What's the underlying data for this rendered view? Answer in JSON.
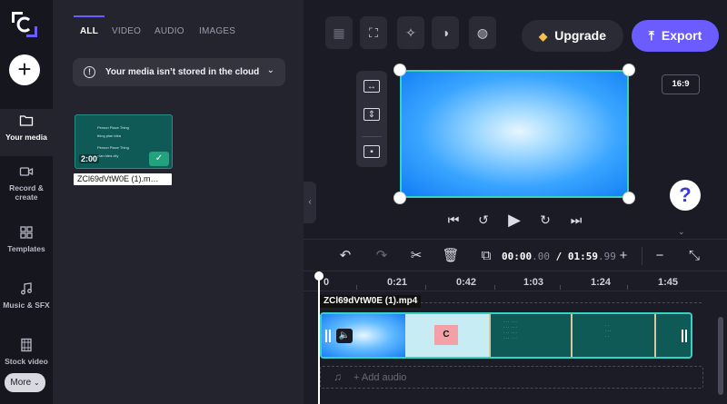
{
  "rail": {
    "items": [
      {
        "label": "Your media",
        "icon": "folder-icon"
      },
      {
        "label": "Record & create",
        "icon": "camera-icon"
      },
      {
        "label": "Templates",
        "icon": "templates-icon"
      },
      {
        "label": "Music & SFX",
        "icon": "music-icon"
      },
      {
        "label": "Stock video",
        "icon": "film-icon"
      }
    ],
    "more_label": "More",
    "add_symbol": "+"
  },
  "media": {
    "tabs": [
      "ALL",
      "VIDEO",
      "AUDIO",
      "IMAGES"
    ],
    "banner_text": "Your media isn’t stored in the cloud",
    "banner_chevron": "⌄",
    "info_symbol": "!",
    "thumb": {
      "duration": "2:00",
      "filename": "ZCl69dVtW0E (1).m…",
      "check": "✓",
      "grid_text": [
        "Person Place Thing",
        "thing plan idea",
        "Person Place Thing",
        "plan idea city"
      ]
    }
  },
  "toolbar": {
    "upgrade_label": "Upgrade",
    "export_label": "Export",
    "tool_icons": [
      "layout-icon",
      "crop-icon",
      "magic-wand-icon",
      "contrast-icon",
      "filter-icon"
    ]
  },
  "preview": {
    "aspect_label": "16:9",
    "help_symbol": "?"
  },
  "timeline": {
    "timecode_current": "00:00",
    "timecode_current_ms": ".00",
    "timecode_sep": " / ",
    "timecode_total": "01:59",
    "timecode_total_ms": ".99",
    "ruler": [
      "0",
      "0:21",
      "0:42",
      "1:03",
      "1:24",
      "1:45"
    ],
    "track_label": "ZCl69dVtW0E (1).mp4",
    "clip_logo": "C",
    "add_audio_label": "+ Add audio"
  },
  "colors": {
    "accent": "#6b5cff",
    "selection": "#38d2c2",
    "rail_bg": "#16161f",
    "panel_bg": "#24242f"
  }
}
